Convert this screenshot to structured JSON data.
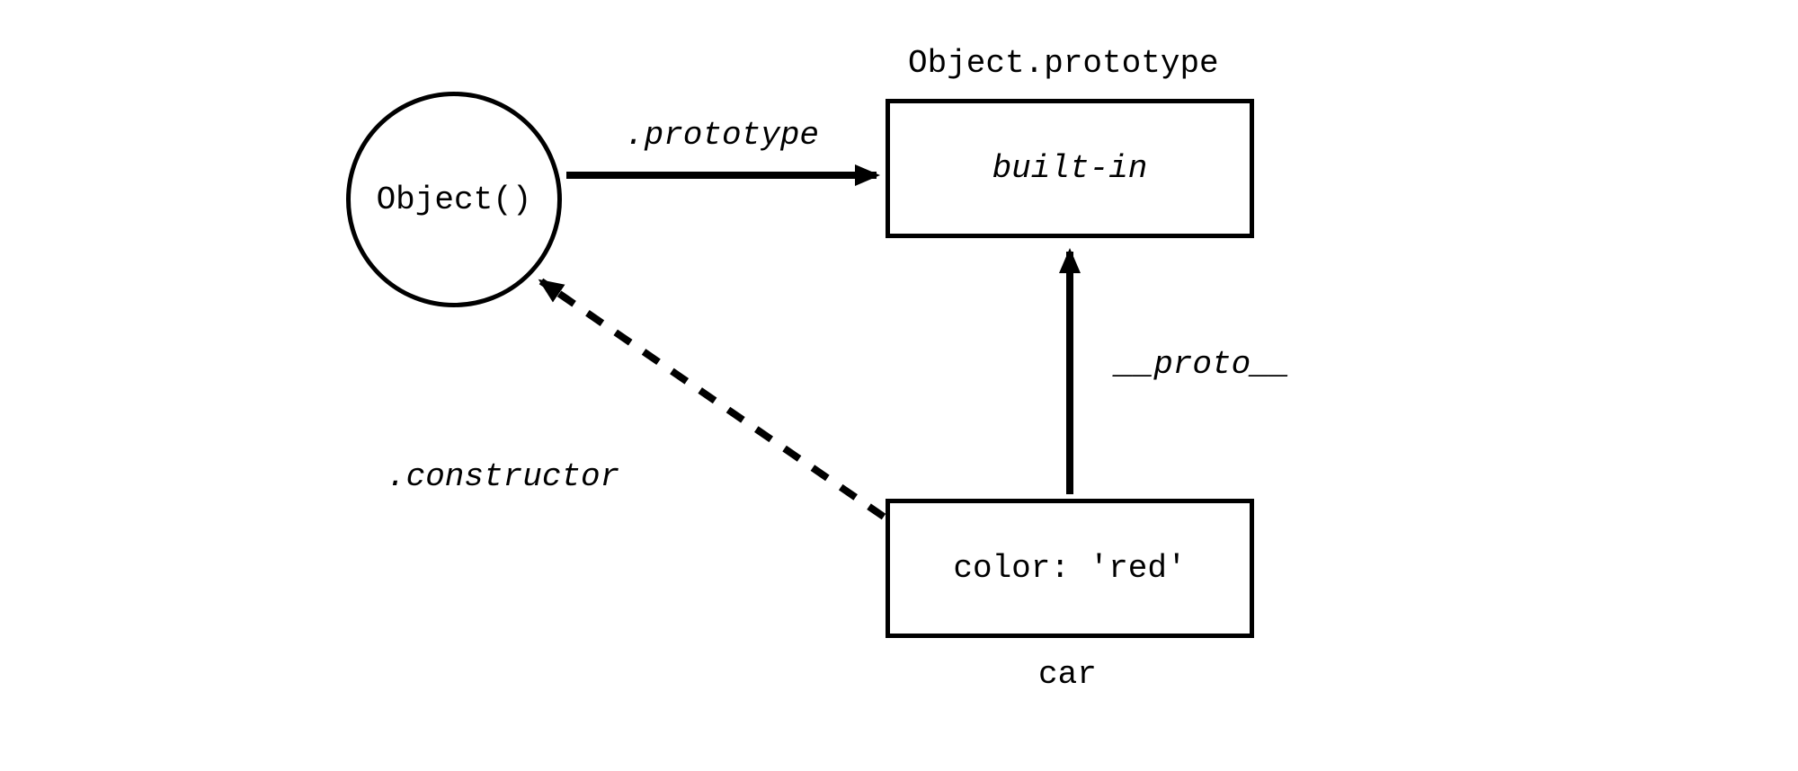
{
  "nodes": {
    "object_fn": {
      "label": "Object()"
    },
    "object_prototype": {
      "title": "Object.prototype",
      "content": "built-in"
    },
    "car": {
      "title": "car",
      "content": "color: 'red'"
    }
  },
  "edges": {
    "prototype": {
      "label": ".prototype"
    },
    "proto": {
      "label": "__proto__"
    },
    "constructor": {
      "label": ".constructor"
    }
  }
}
